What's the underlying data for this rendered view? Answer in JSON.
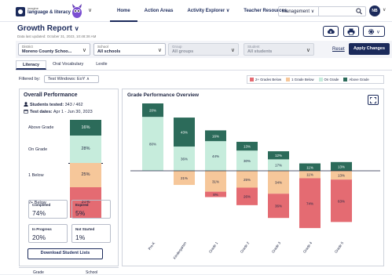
{
  "nav": {
    "logo_small": "imagine",
    "logo_big": "language & literacy",
    "links": [
      "Home",
      "Action Areas",
      "Activity Explorer",
      "Teacher Resources"
    ],
    "dropdown_arrow": "∨",
    "management": "Management",
    "avatar": "NB"
  },
  "header": {
    "title": "Growth Report",
    "updated": "Data last updated: October 31, 2023, 10:48:38 AM"
  },
  "filters": {
    "district_label": "District",
    "district_value": "Moreno County Schoo...",
    "school_label": "School",
    "school_value": "All schools",
    "group_label": "Group",
    "group_value": "All groups",
    "student_label": "Student",
    "student_value": "All students",
    "reset": "Reset",
    "apply": "Apply Changes"
  },
  "tabs": [
    "Literacy",
    "Oral Vocabulary",
    "Lexile"
  ],
  "filtered_by": {
    "label": "Filtered by:",
    "chip": "Test Windows: EoY"
  },
  "legend": {
    "items": [
      {
        "label": "2+ Grades Below",
        "color": "#e46b72"
      },
      {
        "label": "1 Grade Below",
        "color": "#f6c79a"
      },
      {
        "label": "On Grade",
        "color": "#c6ecdc"
      },
      {
        "label": "Above Grade",
        "color": "#2c6b5a"
      }
    ]
  },
  "overall": {
    "title": "Overall Performance",
    "students_label": "Students tested:",
    "students_value": "343 / 462",
    "dates_label": "Test dates:",
    "dates_value": "Apr 1 - Jun 30, 2023",
    "rows": [
      {
        "label": "Above Grade",
        "pct": "16%",
        "value": 16,
        "color": "#2c6b5a",
        "text": "#ffffff"
      },
      {
        "label": "On Grade",
        "pct": "28%",
        "value": 28,
        "color": "#c6ecdc",
        "text": "#1c2340"
      },
      {
        "label": "1 Below",
        "pct": "25%",
        "value": 25,
        "color": "#f6c79a",
        "text": "#1c2340"
      },
      {
        "label": "2+ Below",
        "pct": "31%",
        "value": 31,
        "color": "#e46b72",
        "text": "#1c2340"
      }
    ],
    "stats": [
      {
        "label": "Completed",
        "value": "74%"
      },
      {
        "label": "Expired",
        "value": "5%"
      },
      {
        "label": "In Progress",
        "value": "20%"
      },
      {
        "label": "Not Started",
        "value": "1%"
      }
    ],
    "download": "Download Student Lists"
  },
  "chart_data": {
    "type": "bar",
    "title": "Grade Performance Overview",
    "categories": [
      "Pre-K",
      "Kindergarten",
      "Grade 1",
      "Grade 2",
      "Grade 3",
      "Grade 4",
      "Grade 5"
    ],
    "series": [
      {
        "name": "Above Grade",
        "color": "#2c6b5a",
        "values": [
          20,
          43,
          16,
          13,
          12,
          11,
          13
        ]
      },
      {
        "name": "On Grade",
        "color": "#c6ecdc",
        "values": [
          80,
          36,
          44,
          30,
          17,
          0,
          0
        ]
      },
      {
        "name": "1 Grade Below",
        "color": "#f6c79a",
        "values": [
          0,
          21,
          31,
          25,
          34,
          11,
          13
        ]
      },
      {
        "name": "2+ Grades Below",
        "color": "#e46b72",
        "values": [
          0,
          0,
          8,
          26,
          36,
          74,
          63
        ]
      }
    ],
    "stacking": "diverging (above/on grade above baseline, below grade beneath)"
  },
  "bottom": {
    "col1": "Grade",
    "col2": "School"
  }
}
